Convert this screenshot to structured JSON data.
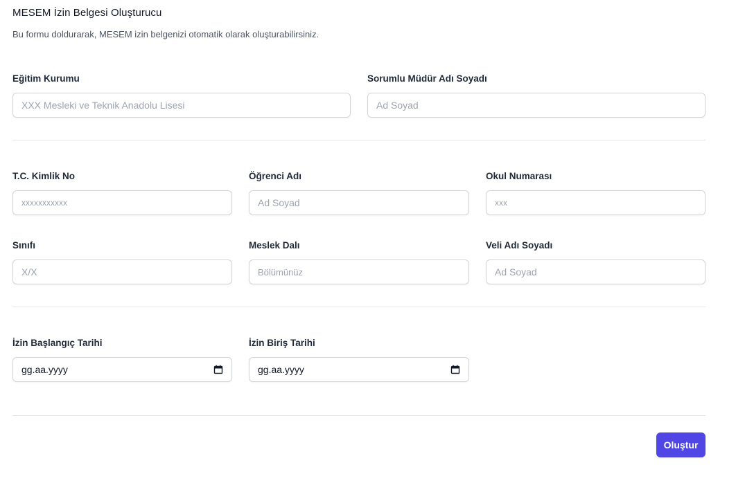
{
  "header": {
    "title": "MESEM İzin Belgesi Oluşturucu",
    "subtitle": "Bu formu doldurarak, MESEM izin belgenizi otomatik olarak oluşturabilirsiniz."
  },
  "school": {
    "institution_label": "Eğitim Kurumu",
    "institution_placeholder": "XXX Mesleki ve Teknik Anadolu Lisesi",
    "principal_label": "Sorumlu Müdür Adı Soyadı",
    "principal_placeholder": "Ad Soyad"
  },
  "student": {
    "tc_label": "T.C. Kimlik No",
    "tc_placeholder": "xxxxxxxxxxx",
    "name_label": "Öğrenci Adı",
    "name_placeholder": "Ad Soyad",
    "number_label": "Okul Numarası",
    "number_placeholder": "xxx",
    "class_label": "Sınıfı",
    "class_placeholder": "X/X",
    "branch_label": "Meslek Dalı",
    "branch_placeholder": "Bölümünüz",
    "parent_label": "Veli Adı Soyadı",
    "parent_placeholder": "Ad Soyad"
  },
  "dates": {
    "start_label": "İzin Başlangıç Tarihi",
    "start_value": "gg.aa.yyyy",
    "end_label": "İzin Biriş Tarihi",
    "end_value": "gg.aa.yyyy",
    "calendar_icon": "calendar-icon"
  },
  "actions": {
    "submit_label": "Oluştur"
  },
  "colors": {
    "accent": "#4f46e5",
    "border": "#d1d5db",
    "divider": "#e5e7eb",
    "placeholder": "#9ca3af"
  }
}
